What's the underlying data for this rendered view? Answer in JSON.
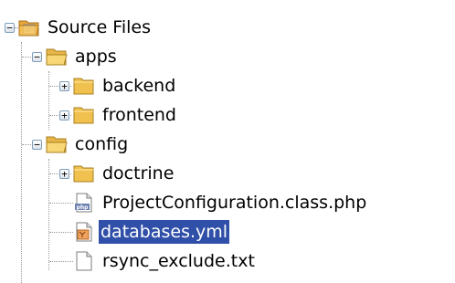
{
  "tree": {
    "items": [
      {
        "label": "Source Files",
        "icon": "source-files-icon",
        "expander": "−"
      },
      {
        "label": "apps",
        "icon": "folder-open-icon",
        "expander": "−"
      },
      {
        "label": "backend",
        "icon": "folder-icon",
        "expander": "+"
      },
      {
        "label": "frontend",
        "icon": "folder-icon",
        "expander": "+"
      },
      {
        "label": "config",
        "icon": "folder-open-icon",
        "expander": "−"
      },
      {
        "label": "doctrine",
        "icon": "folder-icon",
        "expander": "+"
      },
      {
        "label": "ProjectConfiguration.class.php",
        "icon": "php-file-icon"
      },
      {
        "label": "databases.yml",
        "icon": "yml-file-icon",
        "selected": true
      },
      {
        "label": "rsync_exclude.txt",
        "icon": "text-file-icon"
      }
    ],
    "selection_color": "#2f4fa8",
    "folder_color": "#f3c452"
  }
}
